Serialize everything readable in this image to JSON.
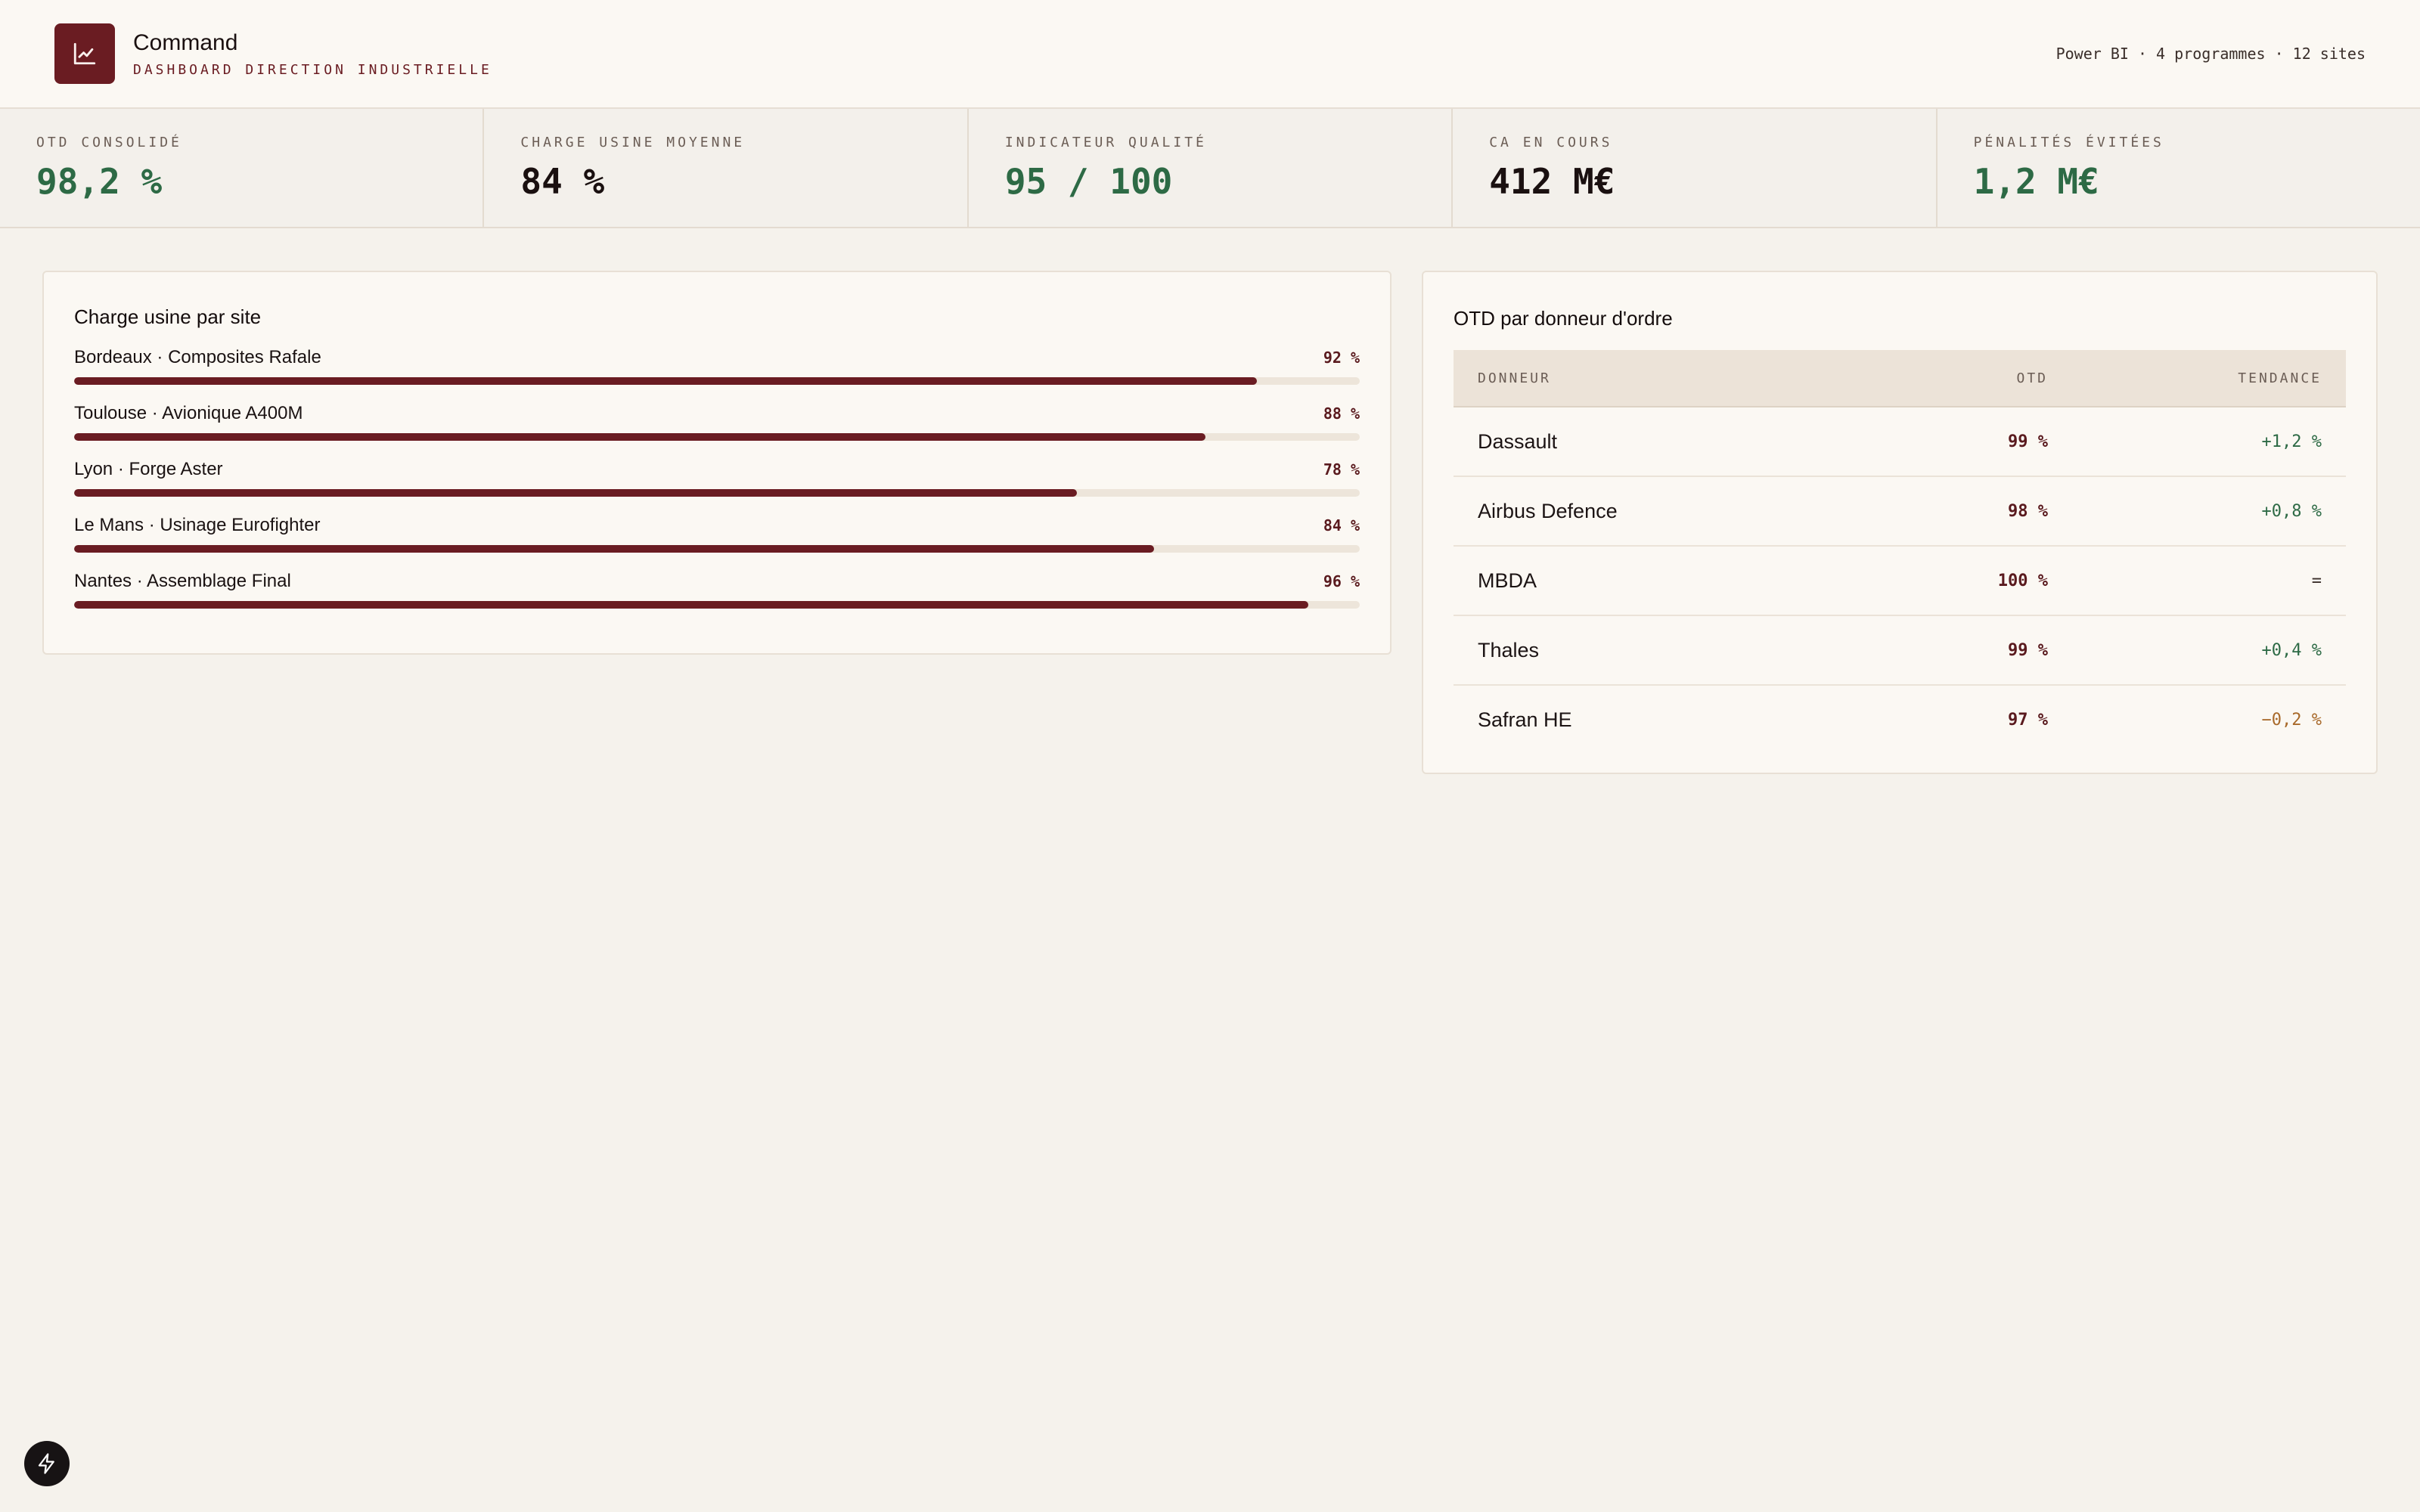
{
  "header": {
    "app_name": "Command",
    "subtitle": "DASHBOARD DIRECTION INDUSTRIELLE",
    "meta": "Power BI · 4 programmes · 12 sites"
  },
  "kpis": [
    {
      "label": "OTD CONSOLIDÉ",
      "value": "98,2 %",
      "color": "#2d6a45"
    },
    {
      "label": "CHARGE USINE MOYENNE",
      "value": "84 %",
      "color": "#1a1010"
    },
    {
      "label": "INDICATEUR QUALITÉ",
      "value": "95 / 100",
      "color": "#2d6a45"
    },
    {
      "label": "CA EN COURS",
      "value": "412 M€",
      "color": "#1a1010"
    },
    {
      "label": "PÉNALITÉS ÉVITÉES",
      "value": "1,2 M€",
      "color": "#2d6a45"
    }
  ],
  "charge": {
    "title": "Charge usine par site",
    "sites": [
      {
        "label": "Bordeaux · Composites Rafale",
        "pct_text": "92 %",
        "value": 92
      },
      {
        "label": "Toulouse · Avionique A400M",
        "pct_text": "88 %",
        "value": 88
      },
      {
        "label": "Lyon · Forge Aster",
        "pct_text": "78 %",
        "value": 78
      },
      {
        "label": "Le Mans · Usinage Eurofighter",
        "pct_text": "84 %",
        "value": 84
      },
      {
        "label": "Nantes · Assemblage Final",
        "pct_text": "96 %",
        "value": 96
      }
    ]
  },
  "otd": {
    "title": "OTD par donneur d'ordre",
    "columns": [
      "DONNEUR",
      "OTD",
      "TENDANCE"
    ],
    "rows": [
      {
        "donneur": "Dassault",
        "otd": "99 %",
        "tendance": "+1,2 %",
        "trend_color": "#2d6a45"
      },
      {
        "donneur": "Airbus Defence",
        "otd": "98 %",
        "tendance": "+0,8 %",
        "trend_color": "#2d6a45"
      },
      {
        "donneur": "MBDA",
        "otd": "100 %",
        "tendance": "=",
        "trend_color": "#3a2e2a"
      },
      {
        "donneur": "Thales",
        "otd": "99 %",
        "tendance": "+0,4 %",
        "trend_color": "#2d6a45"
      },
      {
        "donneur": "Safran HE",
        "otd": "97 %",
        "tendance": "−0,2 %",
        "trend_color": "#a8692a"
      }
    ]
  },
  "colors": {
    "accent": "#6a1c22",
    "positive": "#2d6a45",
    "warning": "#a8692a"
  },
  "icons": {
    "logo": "line-chart-icon",
    "fab": "lightning-icon"
  }
}
